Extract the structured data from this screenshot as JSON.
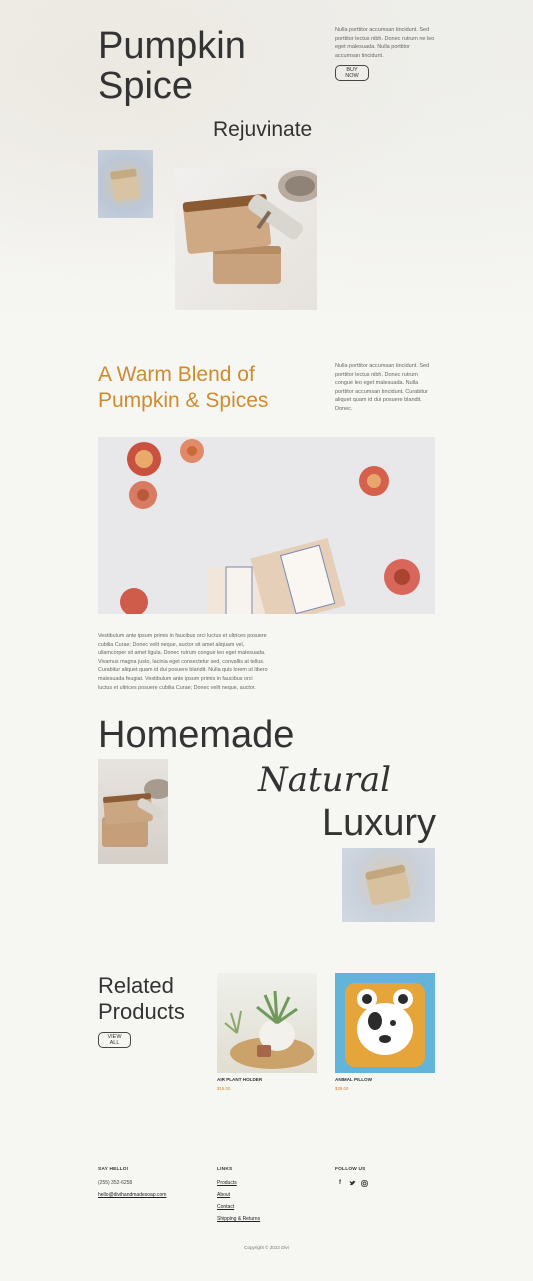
{
  "hero": {
    "title_line1": "Pumpkin",
    "title_line2": "Spice",
    "subtitle": "Rejuvinate",
    "intro_text": "Nulla porttitor accumsan tincidunt. Sed porttitor lectus nibh. Donec rutrum ne leo eget malesuada. Nulla porttitor accumsan tincidunt.",
    "buy_button": "BUY NOW"
  },
  "blend": {
    "title_line1": "A Warm Blend of",
    "title_line2": "Pumpkin & Spices",
    "text": "Nulla porttitor accumsan tincidunt. Sed porttitor lectus nibh. Donec rutrum congue leo eget malesuada. Nulla porttitor accumsan tincidunt. Curabitur aliquet quam id dui posuere blandit. Donec."
  },
  "body_text": "Vestibulum ante ipsum primis in faucibus orci luctus et ultrices posuere cubilia Curae; Donec velit neque, auctor sit amet aliquam vel, ullamcorper sit amet ligula. Donec rutrum congue leo eget malesuada. Vivamus magna justo, lacinia eget consectetur sed, convallis at tellus. Curabitur aliquet quam id dui posuere blandit. Nulla quis lorem ut libero malesuada feugiat. Vestibulum ante ipsum primis in faucibus orci luctus et ultrices posuere cubilia Curae; Donec velit neque, auctor.",
  "tagline": {
    "word1": "Homemade",
    "word2": "Natural",
    "word3": "Luxury"
  },
  "related": {
    "title_line1": "Related",
    "title_line2": "Products",
    "view_all": "VIEW ALL",
    "products": [
      {
        "name": "AIR PLANT HOLDER",
        "price": "$16.00"
      },
      {
        "name": "ANIMAL PILLOW",
        "price": "$28.00"
      }
    ]
  },
  "footer": {
    "say_hello": "SAY HELLO!",
    "phone": "(255) 352-6258",
    "email": "hello@divihandmadesoap.com",
    "links_head": "LINKS",
    "links": [
      "Products",
      "About",
      "Contact",
      "Shipping & Returns"
    ],
    "follow_head": "FOLLOW US",
    "social_icons": [
      "facebook-icon",
      "twitter-icon",
      "instagram-icon"
    ],
    "copyright": "Copyright © 2022 Divi"
  },
  "colors": {
    "accent": "#d08b2c",
    "background": "#f6f6f3",
    "text": "#333333"
  }
}
